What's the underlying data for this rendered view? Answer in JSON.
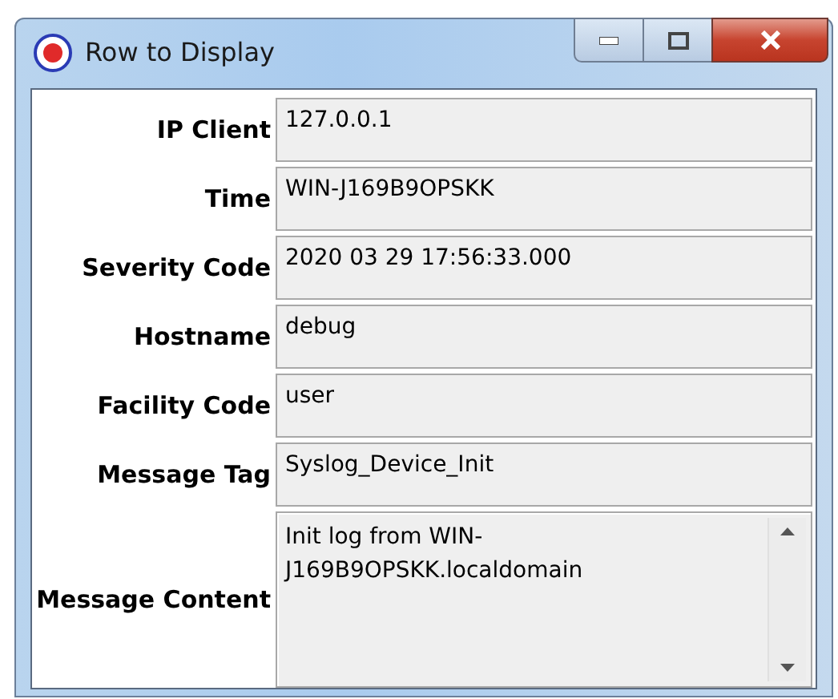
{
  "window": {
    "title": "Row to Display"
  },
  "fields": [
    {
      "label": "IP Client",
      "value": "127.0.0.1",
      "kind": "text"
    },
    {
      "label": "Time",
      "value": "WIN-J169B9OPSKK",
      "kind": "text"
    },
    {
      "label": "Severity Code",
      "value": "2020 03 29 17:56:33.000",
      "kind": "text"
    },
    {
      "label": "Hostname",
      "value": "debug",
      "kind": "text"
    },
    {
      "label": "Facility Code",
      "value": "user",
      "kind": "text"
    },
    {
      "label": "Message Tag",
      "value": "Syslog_Device_Init",
      "kind": "text"
    },
    {
      "label": "Message Content",
      "value": "Init log from WIN-\nJ169B9OPSKK.localdomain",
      "kind": "textarea"
    }
  ]
}
